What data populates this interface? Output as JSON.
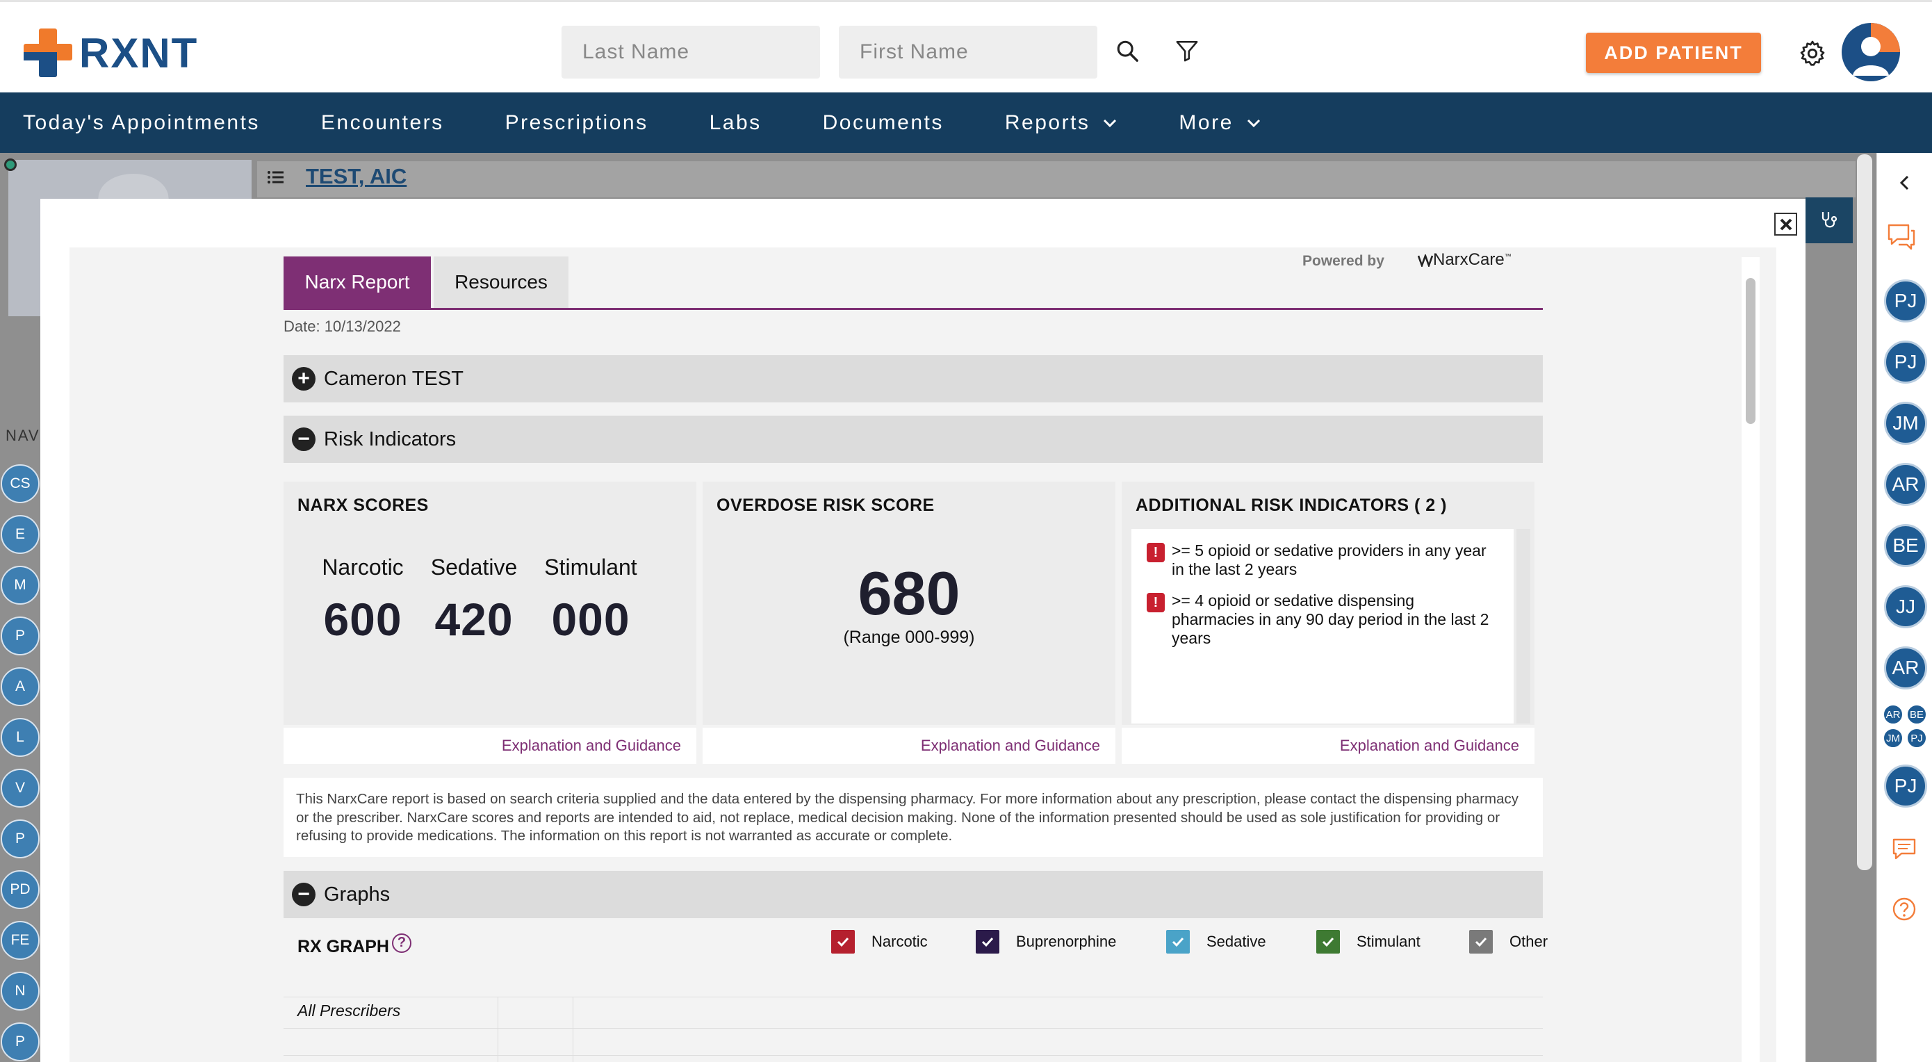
{
  "header": {
    "logo_text": "RXNT",
    "last_name_placeholder": "Last Name",
    "first_name_placeholder": "First Name",
    "add_patient_label": "ADD PATIENT"
  },
  "nav": {
    "items": [
      {
        "label": "Today's Appointments"
      },
      {
        "label": "Encounters"
      },
      {
        "label": "Prescriptions"
      },
      {
        "label": "Labs"
      },
      {
        "label": "Documents"
      },
      {
        "label": "Reports"
      },
      {
        "label": "More"
      }
    ]
  },
  "background": {
    "patient_name": "TEST, AIC",
    "left_nav_label": "NAV",
    "left_nav_items": [
      "CS",
      "E",
      "M",
      "P",
      "A",
      "L",
      "V",
      "P",
      "PD",
      "FE",
      "N",
      "P"
    ]
  },
  "right_rail": {
    "users": [
      "PJ",
      "PJ",
      "JM",
      "AR",
      "BE",
      "JJ",
      "AR"
    ],
    "group": [
      "AR",
      "BE",
      "JM",
      "PJ"
    ],
    "last_user": "PJ"
  },
  "report": {
    "tabs": [
      {
        "label": "Narx Report"
      },
      {
        "label": "Resources"
      }
    ],
    "powered_by": "Powered by",
    "brand": "NarxCare",
    "date": "Date: 10/13/2022",
    "sections": {
      "patient": "Cameron TEST",
      "risk": "Risk Indicators",
      "graphs": "Graphs"
    },
    "narx_scores": {
      "title": "NARX SCORES",
      "scores": [
        {
          "label": "Narcotic",
          "value": "600"
        },
        {
          "label": "Sedative",
          "value": "420"
        },
        {
          "label": "Stimulant",
          "value": "000"
        }
      ]
    },
    "overdose": {
      "title": "OVERDOSE RISK SCORE",
      "score": "680",
      "range": "(Range 000-999)"
    },
    "additional": {
      "title": "ADDITIONAL RISK INDICATORS ( 2 )",
      "items": [
        ">= 5 opioid or sedative providers in any year in the last 2 years",
        ">= 4 opioid or sedative dispensing pharmacies in any 90 day period in the last 2 years"
      ]
    },
    "guidance_link": "Explanation and Guidance",
    "disclaimer": "This NarxCare report is based on search criteria supplied and the data entered by the dispensing pharmacy. For more information about any prescription, please contact the dispensing pharmacy or the prescriber. NarxCare scores and reports are intended to aid, not replace, medical decision making. None of the information presented should be used as sole justification for providing or refusing to provide medications. The information on this report is not warranted as accurate or complete.",
    "rx_graph": {
      "title": "RX GRAPH",
      "legend": [
        {
          "label": "Narcotic",
          "color": "#b5202e"
        },
        {
          "label": "Buprenorphine",
          "color": "#2b1a4a"
        },
        {
          "label": "Sedative",
          "color": "#4aa3c8"
        },
        {
          "label": "Stimulant",
          "color": "#3e7a32"
        },
        {
          "label": "Other",
          "color": "#7a7a7a"
        }
      ],
      "row_label": "All Prescribers"
    }
  },
  "colors": {
    "brand_orange": "#f37d3a",
    "brand_blue": "#1c4f86",
    "nav_bg": "#153d5e",
    "narx_purple": "#7e2f74"
  }
}
